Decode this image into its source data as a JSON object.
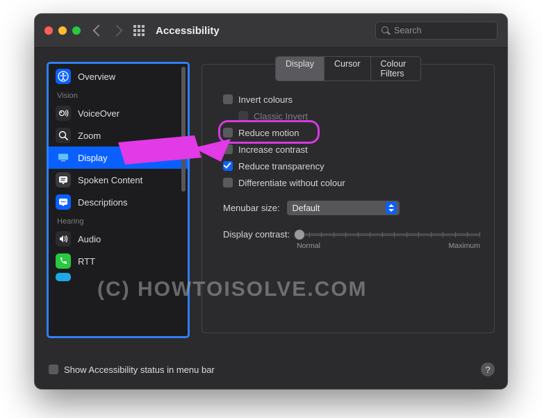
{
  "window": {
    "title": "Accessibility",
    "search_placeholder": "Search"
  },
  "sidebar": {
    "sections": {
      "s0": "",
      "vision": "Vision",
      "hearing": "Hearing"
    },
    "items": {
      "overview": {
        "label": "Overview"
      },
      "voiceover": {
        "label": "VoiceOver"
      },
      "zoom": {
        "label": "Zoom"
      },
      "display": {
        "label": "Display"
      },
      "spoken": {
        "label": "Spoken Content"
      },
      "descriptions": {
        "label": "Descriptions"
      },
      "audio": {
        "label": "Audio"
      },
      "rtt": {
        "label": "RTT"
      }
    }
  },
  "tabs": {
    "display": "Display",
    "cursor": "Cursor",
    "colour_filters": "Colour Filters"
  },
  "options": {
    "invert_colours": "Invert colours",
    "classic_invert": "Classic Invert",
    "reduce_motion": "Reduce motion",
    "increase_contrast": "Increase contrast",
    "reduce_transparency": "Reduce transparency",
    "differentiate": "Differentiate without colour"
  },
  "menubar": {
    "label": "Menubar size:",
    "value": "Default"
  },
  "contrast": {
    "label": "Display contrast:",
    "min_label": "Normal",
    "max_label": "Maximum"
  },
  "footer": {
    "show_status": "Show Accessibility status in menu bar"
  },
  "watermark": "(C) HOWTOISOLVE.COM"
}
